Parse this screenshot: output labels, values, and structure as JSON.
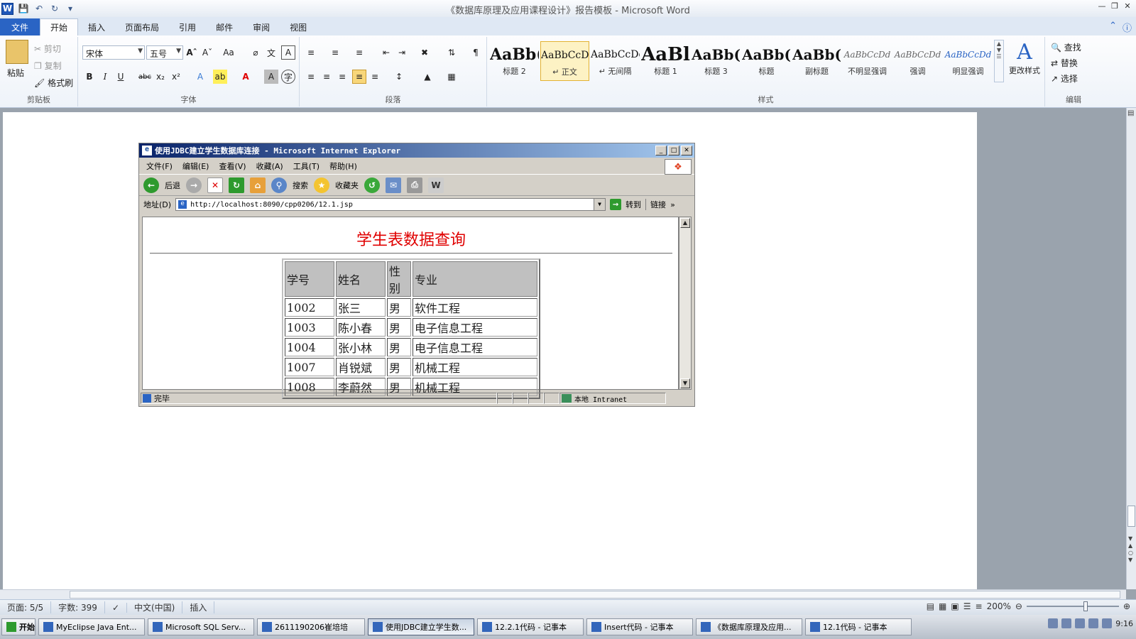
{
  "window": {
    "title": "《数据库原理及应用课程设计》报告模板 - Microsoft Word"
  },
  "quick_access": {
    "logo": "W"
  },
  "tabs": [
    "文件",
    "开始",
    "插入",
    "页面布局",
    "引用",
    "邮件",
    "审阅",
    "视图"
  ],
  "ribbon": {
    "clipboard": {
      "paste": "粘贴",
      "cut": "剪切",
      "copy": "复制",
      "format_painter": "格式刷",
      "label": "剪贴板"
    },
    "font": {
      "name": "宋体",
      "size": "五号",
      "label": "字体"
    },
    "paragraph": {
      "label": "段落"
    },
    "styles": {
      "label": "样式",
      "items": [
        {
          "preview": "AaBb(",
          "label": "标题 2",
          "size": "22px",
          "bold": true
        },
        {
          "preview": "AaBbCcDc",
          "label": "↵ 正文",
          "size": "14px",
          "bold": false
        },
        {
          "preview": "AaBbCcDc",
          "label": "↵ 无间隔",
          "size": "14px",
          "bold": false
        },
        {
          "preview": "AaBl",
          "label": "标题 1",
          "size": "26px",
          "bold": true
        },
        {
          "preview": "AaBb(",
          "label": "标题 3",
          "size": "20px",
          "bold": true
        },
        {
          "preview": "AaBb(",
          "label": "标题",
          "size": "20px",
          "bold": true
        },
        {
          "preview": "AaBb(",
          "label": "副标题",
          "size": "20px",
          "bold": true
        },
        {
          "preview": "AaBbCcDd",
          "label": "不明显强调",
          "size": "12px",
          "bold": false
        },
        {
          "preview": "AaBbCcDd",
          "label": "强调",
          "size": "12px",
          "bold": false
        },
        {
          "preview": "AaBbCcDd",
          "label": "明显强调",
          "size": "12px",
          "bold": false
        }
      ],
      "change_styles": "更改样式"
    },
    "editing": {
      "find": "查找",
      "replace": "替换",
      "select": "选择",
      "label": "编辑"
    }
  },
  "ie": {
    "title": "使用JDBC建立学生数据库连接 - Microsoft Internet Explorer",
    "menu": [
      "文件(F)",
      "编辑(E)",
      "查看(V)",
      "收藏(A)",
      "工具(T)",
      "帮助(H)"
    ],
    "toolbar": {
      "back": "后退",
      "search": "搜索",
      "favorites": "收藏夹"
    },
    "address": {
      "label": "地址(D)",
      "url": "http://localhost:8090/cpp0206/12.1.jsp",
      "go": "转到",
      "links": "链接"
    },
    "heading": "学生表数据查询",
    "table": {
      "headers": [
        "学号",
        "姓名",
        "性别",
        "专业"
      ],
      "rows": [
        [
          "1002",
          "张三",
          "男",
          "软件工程"
        ],
        [
          "1003",
          "陈小春",
          "男",
          "电子信息工程"
        ],
        [
          "1004",
          "张小林",
          "男",
          "电子信息工程"
        ],
        [
          "1007",
          "肖锐斌",
          "男",
          "机械工程"
        ],
        [
          "1008",
          "李蔚然",
          "男",
          "机械工程"
        ]
      ]
    },
    "status": {
      "left": "完毕",
      "zone": "本地 Intranet"
    }
  },
  "statusbar": {
    "page": "页面: 5/5",
    "words": "字数: 399",
    "language": "中文(中国)",
    "insert": "插入",
    "zoom": "200%"
  },
  "taskbar": {
    "start": "开始",
    "items": [
      {
        "label": "MyEclipse Java Ent...",
        "active": false
      },
      {
        "label": "Microsoft SQL Serv...",
        "active": false
      },
      {
        "label": "2611190206崔培培",
        "active": false
      },
      {
        "label": "使用JDBC建立学生数...",
        "active": true
      },
      {
        "label": "12.2.1代码 - 记事本",
        "active": false
      },
      {
        "label": "Insert代码 - 记事本",
        "active": false
      },
      {
        "label": "《数据库原理及应用...",
        "active": false
      },
      {
        "label": "12.1代码 - 记事本",
        "active": false
      }
    ],
    "clock": "9:16"
  }
}
